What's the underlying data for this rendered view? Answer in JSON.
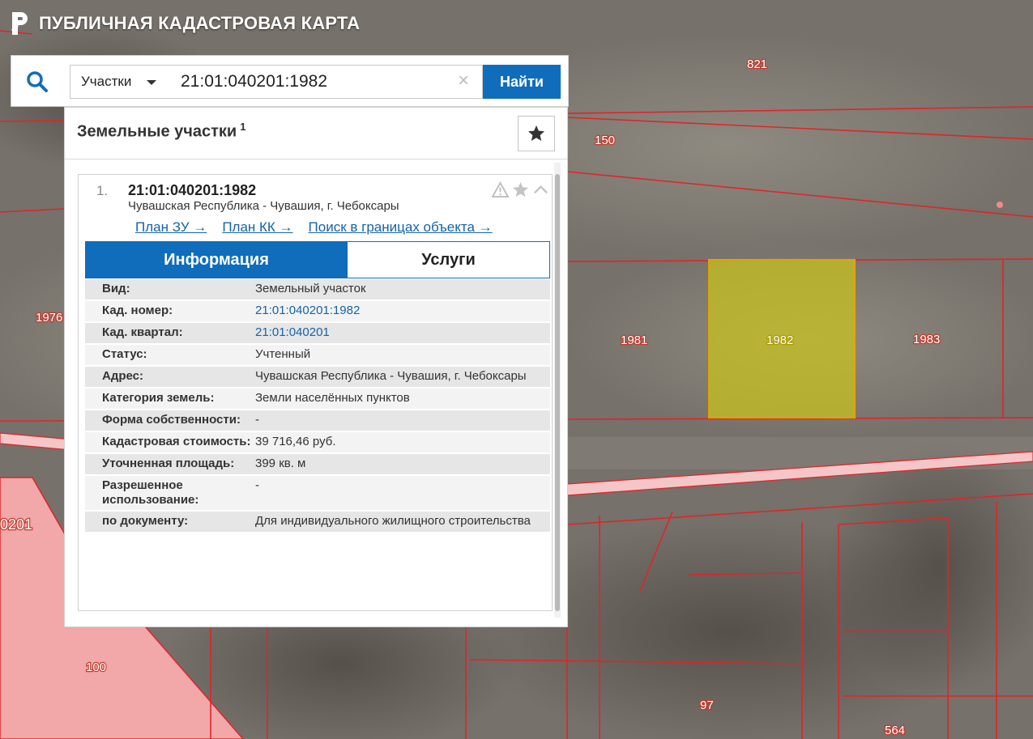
{
  "header": {
    "title": "ПУБЛИЧНАЯ КАДАСТРОВАЯ КАРТА"
  },
  "search": {
    "type_label": "Участки",
    "value": "21:01:040201:1982",
    "find_label": "Найти"
  },
  "results": {
    "title": "Земельные участки",
    "count": "1",
    "items": [
      {
        "index": "1.",
        "number": "21:01:040201:1982",
        "address": "Чувашская Республика - Чувашия, г. Чебоксары",
        "links": [
          "План ЗУ →",
          "План КК →",
          "Поиск в границах объекта →"
        ],
        "tabs": [
          "Информация",
          "Услуги"
        ],
        "info": [
          {
            "key": "Вид:",
            "value": "Земельный участок"
          },
          {
            "key": "Кад. номер:",
            "value": "21:01:040201:1982"
          },
          {
            "key": "Кад. квартал:",
            "value": "21:01:040201"
          },
          {
            "key": "Статус:",
            "value": "Учтенный"
          },
          {
            "key": "Адрес:",
            "value": "Чувашская Республика - Чувашия, г. Чебоксары"
          },
          {
            "key": "Категория земель:",
            "value": "Земли населённых пунктов"
          },
          {
            "key": "Форма собственности:",
            "value": "-"
          },
          {
            "key": "Кадастровая стоимость:",
            "value": "39 716,46 руб."
          },
          {
            "key": "Уточненная площадь:",
            "value": "399 кв. м"
          },
          {
            "key": "Разрешенное использование:",
            "value": "-"
          },
          {
            "key": "по документу:",
            "value": "Для индивидуального жилищного строительства"
          }
        ]
      }
    ]
  },
  "map": {
    "parcel_labels": [
      "821",
      "150",
      "1976",
      "1981",
      "1982",
      "1983",
      "0201",
      "100",
      "97",
      "564"
    ],
    "selected_parcel": "1982",
    "colors": {
      "boundary": "#e0242a",
      "selected_fill": "#c7c21f",
      "selected_border": "#e0a500",
      "accent": "#0f6dbb",
      "link": "#1463a8"
    }
  }
}
